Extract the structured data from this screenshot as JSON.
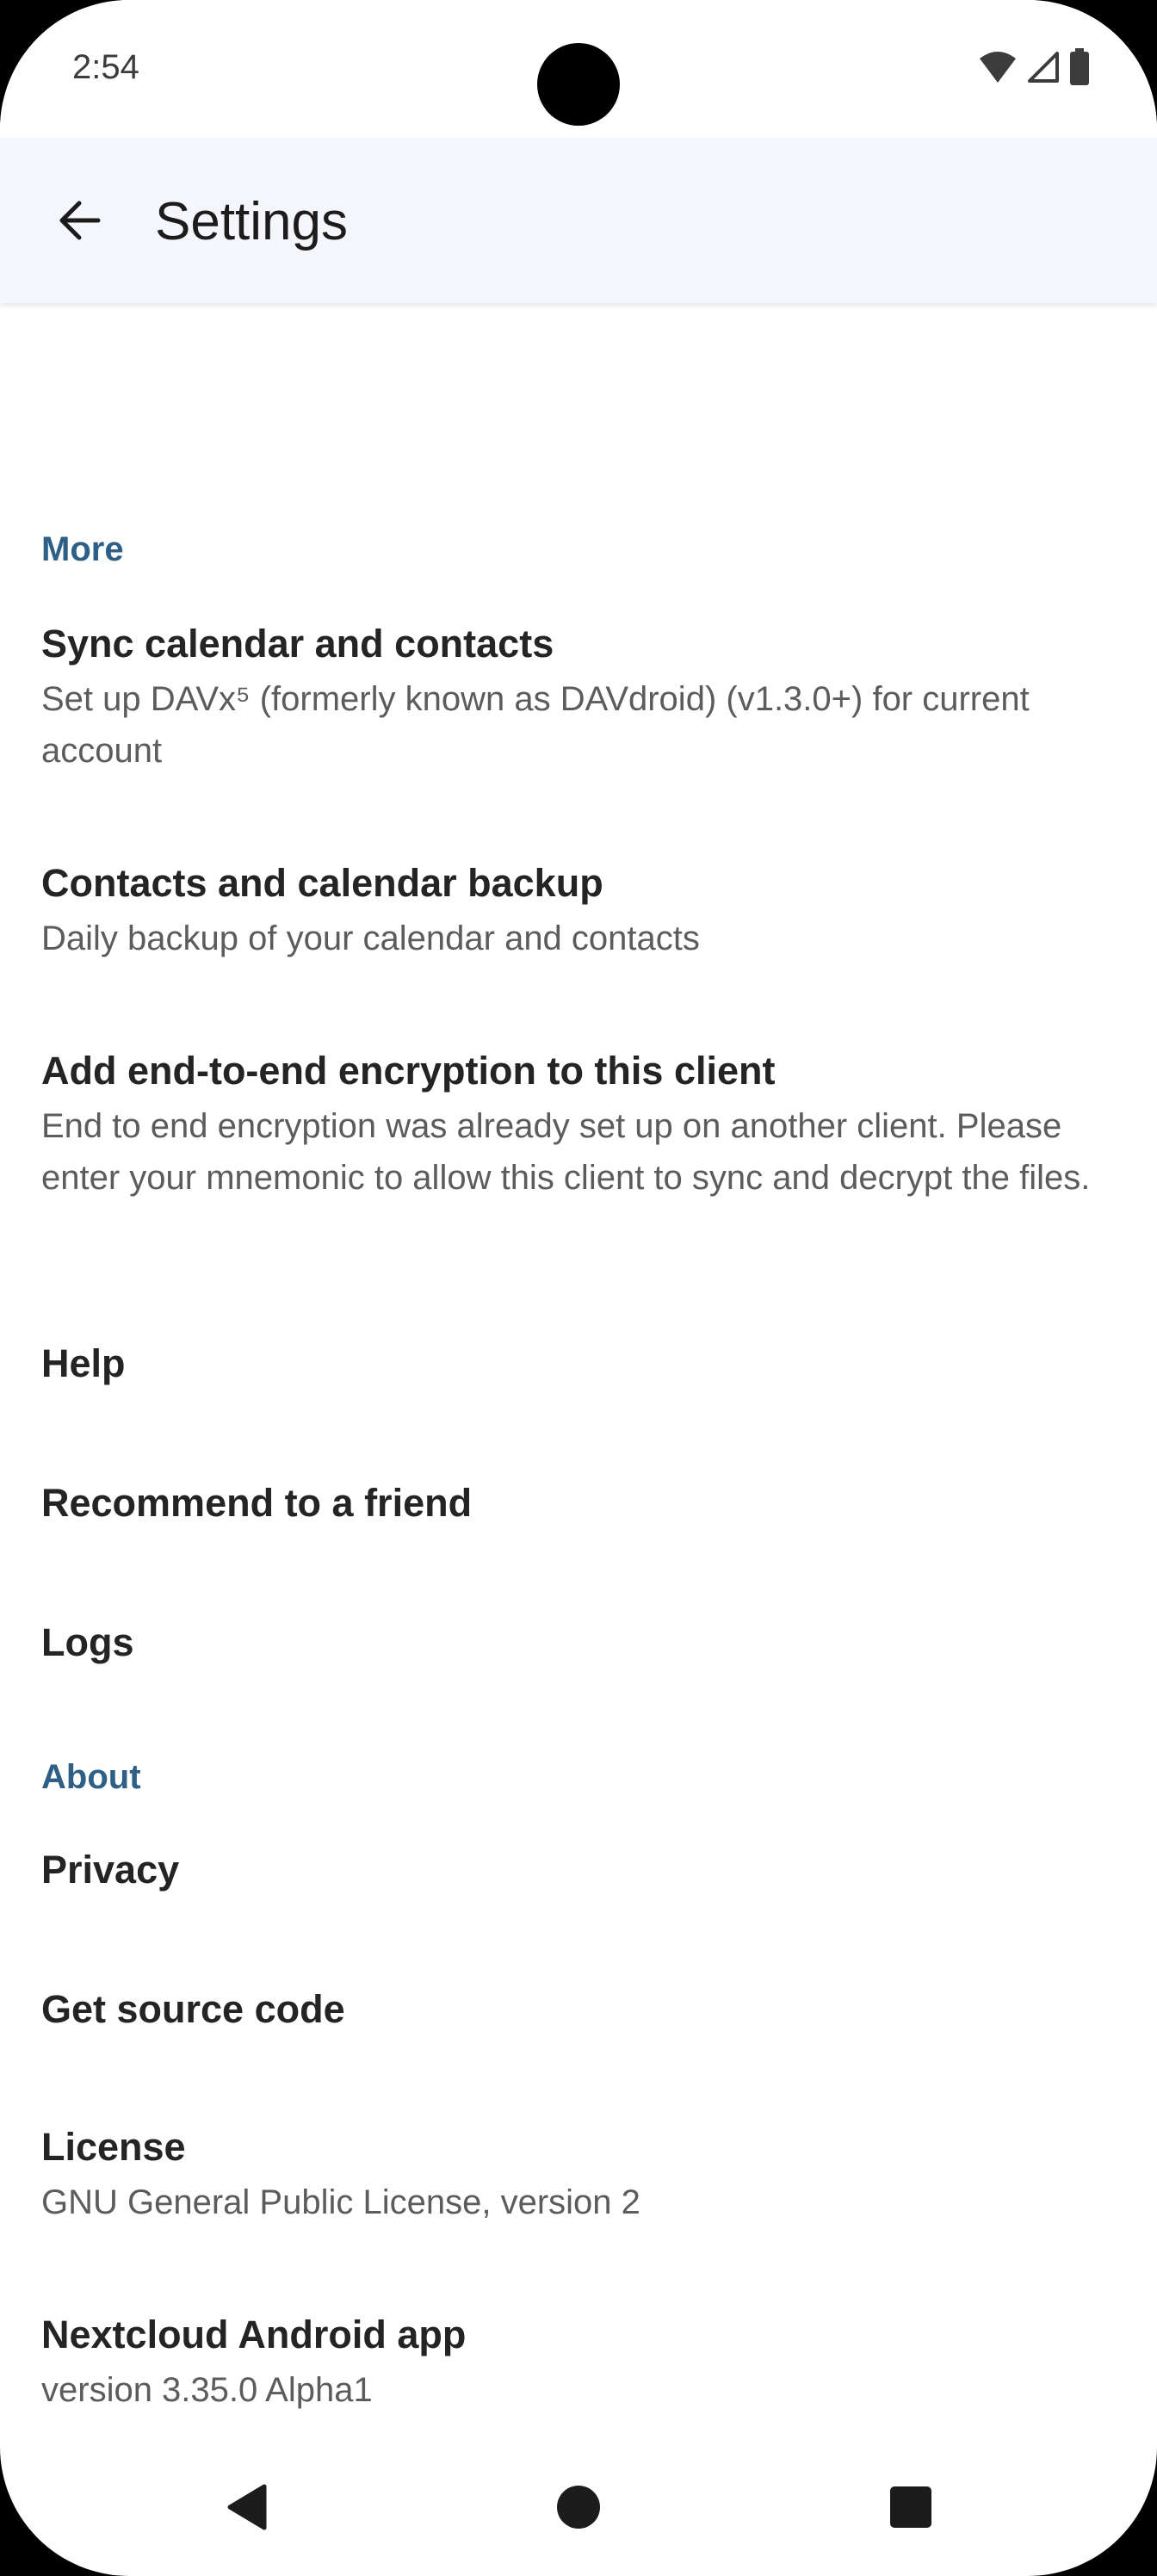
{
  "status_bar": {
    "time": "2:54"
  },
  "app_bar": {
    "title": "Settings"
  },
  "sections": {
    "more": {
      "header": "More",
      "sync": {
        "title": "Sync calendar and contacts",
        "summary": "Set up DAVx⁵ (formerly known as DAVdroid) (v1.3.0+) for current account"
      },
      "backup": {
        "title": "Contacts and calendar backup",
        "summary": "Daily backup of your calendar and contacts"
      },
      "e2ee": {
        "title": "Add end-to-end encryption to this client",
        "summary": "End to end encryption was already set up on another client. Please enter your mnemonic to allow this client to sync and decrypt the files."
      },
      "help": {
        "title": "Help"
      },
      "recommend": {
        "title": "Recommend to a friend"
      },
      "logs": {
        "title": "Logs"
      }
    },
    "about": {
      "header": "About",
      "privacy": {
        "title": "Privacy"
      },
      "source": {
        "title": "Get source code"
      },
      "license": {
        "title": "License",
        "summary": "GNU General Public License, version 2"
      },
      "app": {
        "title": "Nextcloud Android app",
        "summary": "version 3.35.0 Alpha1"
      }
    }
  },
  "colors": {
    "accent": "#2e5f86",
    "app_bar_bg": "#f4f6fc",
    "title_text": "#242424",
    "summary_text": "#5c5c5c"
  }
}
